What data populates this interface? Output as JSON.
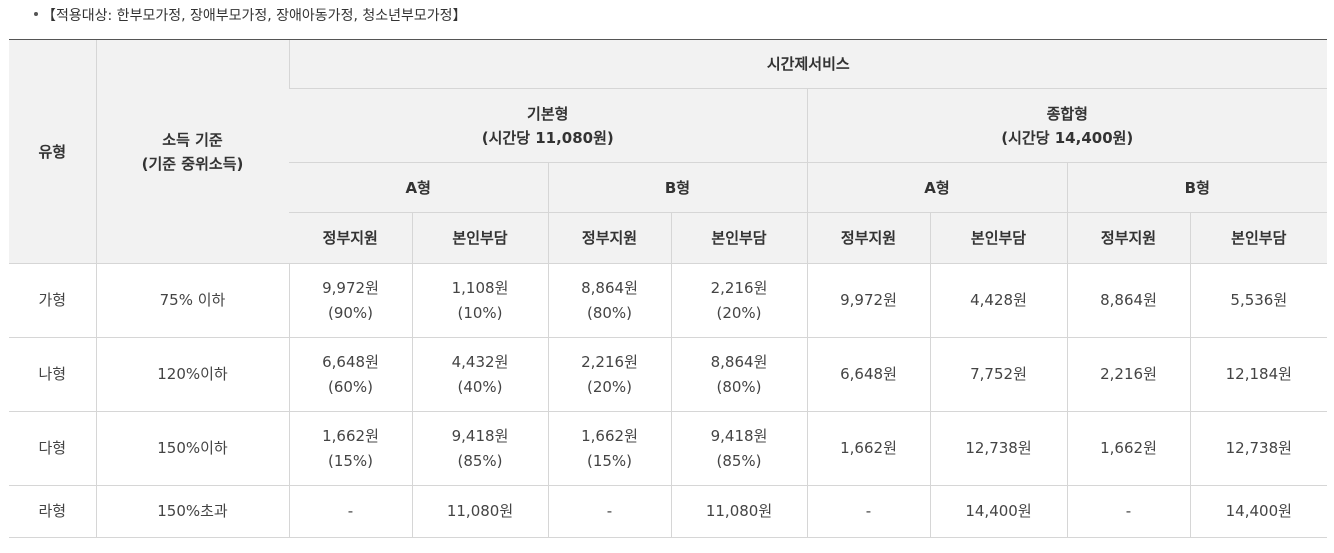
{
  "note": "【적용대상: 한부모가정, 장애부모가정, 장애아동가정, 청소년부모가정】",
  "header": {
    "type": "유형",
    "income_line1": "소득 기준",
    "income_line2": "(기준 중위소득)",
    "service": "시간제서비스",
    "basic_line1": "기본형",
    "basic_line2": "(시간당 11,080원)",
    "combined_line1": "종합형",
    "combined_line2": "(시간당 14,400원)",
    "type_a": "A형",
    "type_b": "B형",
    "gov": "정부지원",
    "self": "본인부담"
  },
  "rows": [
    {
      "type": "가형",
      "income": "75% 이하",
      "ba_gov": "9,972원",
      "ba_gov_pct": "(90%)",
      "ba_self": "1,108원",
      "ba_self_pct": "(10%)",
      "bb_gov": "8,864원",
      "bb_gov_pct": "(80%)",
      "bb_self": "2,216원",
      "bb_self_pct": "(20%)",
      "ca_gov": "9,972원",
      "ca_self": "4,428원",
      "cb_gov": "8,864원",
      "cb_self": "5,536원"
    },
    {
      "type": "나형",
      "income": "120%이하",
      "ba_gov": "6,648원",
      "ba_gov_pct": "(60%)",
      "ba_self": "4,432원",
      "ba_self_pct": "(40%)",
      "bb_gov": "2,216원",
      "bb_gov_pct": "(20%)",
      "bb_self": "8,864원",
      "bb_self_pct": "(80%)",
      "ca_gov": "6,648원",
      "ca_self": "7,752원",
      "cb_gov": "2,216원",
      "cb_self": "12,184원"
    },
    {
      "type": "다형",
      "income": "150%이하",
      "ba_gov": "1,662원",
      "ba_gov_pct": "(15%)",
      "ba_self": "9,418원",
      "ba_self_pct": "(85%)",
      "bb_gov": "1,662원",
      "bb_gov_pct": "(15%)",
      "bb_self": "9,418원",
      "bb_self_pct": "(85%)",
      "ca_gov": "1,662원",
      "ca_self": "12,738원",
      "cb_gov": "1,662원",
      "cb_self": "12,738원"
    },
    {
      "type": "라형",
      "income": "150%초과",
      "ba_gov": "-",
      "ba_self": "11,080원",
      "bb_gov": "-",
      "bb_self": "11,080원",
      "ca_gov": "-",
      "ca_self": "14,400원",
      "cb_gov": "-",
      "cb_self": "14,400원"
    }
  ]
}
